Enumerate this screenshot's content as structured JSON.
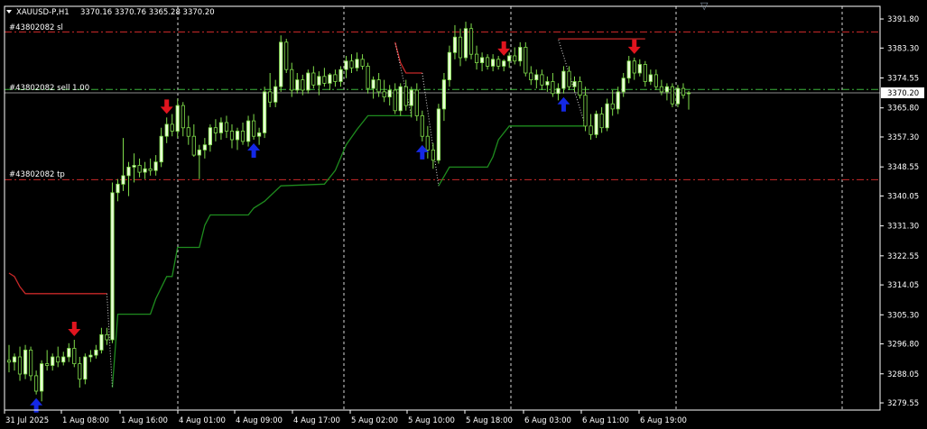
{
  "header": {
    "symbol_line": "XAUUSD-P,H1",
    "ohlc": "3370.16 3370.76 3365.28 3370.20"
  },
  "order_lines": {
    "sl_label": "#43802082 sl",
    "entry_label": "#43802082 sell 1.00",
    "tp_label": "#43802082 tp",
    "sl_price": 3388.0,
    "entry_price": 3371.2,
    "tp_price": 3344.8
  },
  "colors": {
    "background": "#000000",
    "bull_candle": "#e8ffd6",
    "bear_candle": "#000000",
    "candle_outline": "#7fdc4a",
    "trail_up": "#1e8c1e",
    "trail_down": "#c82828",
    "sell_arrow": "#e0141e",
    "buy_arrow": "#1428e6",
    "sl_tp_line": "#c82828",
    "entry_line": "#3cb43c",
    "current_price_line": "#8c8c8c",
    "grid_line": "#ffffff"
  },
  "chart_data": {
    "type": "candlestick",
    "title": "XAUUSD-P,H1",
    "ylim": [
      3277.45,
      3395.5
    ],
    "y_ticks": [
      3391.8,
      3383.3,
      3374.55,
      3365.8,
      3357.3,
      3348.55,
      3340.05,
      3331.3,
      3322.55,
      3314.05,
      3305.3,
      3296.8,
      3288.05,
      3279.55
    ],
    "x_tick_labels": [
      "31 Jul 2025",
      "1 Aug 08:00",
      "1 Aug 16:00",
      "4 Aug 01:00",
      "4 Aug 09:00",
      "4 Aug 17:00",
      "5 Aug 02:00",
      "5 Aug 10:00",
      "5 Aug 18:00",
      "6 Aug 03:00",
      "6 Aug 11:00",
      "6 Aug 19:00"
    ],
    "current_price": 3370.2,
    "candles": [
      {
        "o": 3292.0,
        "h": 3296.5,
        "l": 3288.5,
        "c": 3291.5
      },
      {
        "o": 3291.5,
        "h": 3294.0,
        "l": 3289.0,
        "c": 3293.0
      },
      {
        "o": 3293.0,
        "h": 3296.0,
        "l": 3286.0,
        "c": 3288.0
      },
      {
        "o": 3288.0,
        "h": 3296.5,
        "l": 3286.5,
        "c": 3295.0
      },
      {
        "o": 3295.0,
        "h": 3296.0,
        "l": 3286.0,
        "c": 3287.5
      },
      {
        "o": 3287.5,
        "h": 3289.0,
        "l": 3282.0,
        "c": 3283.0
      },
      {
        "o": 3283.0,
        "h": 3292.0,
        "l": 3280.0,
        "c": 3291.0
      },
      {
        "o": 3291.0,
        "h": 3295.0,
        "l": 3289.0,
        "c": 3290.5
      },
      {
        "o": 3290.5,
        "h": 3294.0,
        "l": 3289.0,
        "c": 3293.0
      },
      {
        "o": 3293.0,
        "h": 3296.0,
        "l": 3290.0,
        "c": 3291.5
      },
      {
        "o": 3291.5,
        "h": 3294.5,
        "l": 3290.5,
        "c": 3293.0
      },
      {
        "o": 3293.0,
        "h": 3297.0,
        "l": 3291.5,
        "c": 3295.5
      },
      {
        "o": 3295.5,
        "h": 3298.0,
        "l": 3290.0,
        "c": 3291.0
      },
      {
        "o": 3291.0,
        "h": 3293.0,
        "l": 3284.0,
        "c": 3286.5
      },
      {
        "o": 3286.5,
        "h": 3294.0,
        "l": 3285.0,
        "c": 3293.0
      },
      {
        "o": 3293.0,
        "h": 3295.0,
        "l": 3291.5,
        "c": 3293.5
      },
      {
        "o": 3293.5,
        "h": 3296.5,
        "l": 3292.5,
        "c": 3295.0
      },
      {
        "o": 3295.0,
        "h": 3301.5,
        "l": 3294.0,
        "c": 3299.5
      },
      {
        "o": 3299.5,
        "h": 3301.5,
        "l": 3296.5,
        "c": 3298.0
      },
      {
        "o": 3298.0,
        "h": 3344.0,
        "l": 3297.0,
        "c": 3341.0
      },
      {
        "o": 3341.0,
        "h": 3345.0,
        "l": 3338.5,
        "c": 3343.5
      },
      {
        "o": 3343.5,
        "h": 3357.0,
        "l": 3341.5,
        "c": 3346.0
      },
      {
        "o": 3346.0,
        "h": 3350.0,
        "l": 3340.0,
        "c": 3348.5
      },
      {
        "o": 3348.5,
        "h": 3352.5,
        "l": 3344.0,
        "c": 3349.0
      },
      {
        "o": 3349.0,
        "h": 3351.0,
        "l": 3345.5,
        "c": 3347.0
      },
      {
        "o": 3347.0,
        "h": 3350.0,
        "l": 3345.0,
        "c": 3348.0
      },
      {
        "o": 3348.0,
        "h": 3351.0,
        "l": 3346.0,
        "c": 3347.5
      },
      {
        "o": 3347.5,
        "h": 3352.0,
        "l": 3346.0,
        "c": 3350.0
      },
      {
        "o": 3350.0,
        "h": 3360.0,
        "l": 3348.5,
        "c": 3357.5
      },
      {
        "o": 3357.5,
        "h": 3363.0,
        "l": 3355.5,
        "c": 3361.0
      },
      {
        "o": 3361.0,
        "h": 3364.0,
        "l": 3357.5,
        "c": 3359.0
      },
      {
        "o": 3359.0,
        "h": 3368.5,
        "l": 3357.0,
        "c": 3366.5
      },
      {
        "o": 3366.5,
        "h": 3367.5,
        "l": 3357.5,
        "c": 3360.0
      },
      {
        "o": 3360.0,
        "h": 3363.5,
        "l": 3355.0,
        "c": 3357.5
      },
      {
        "o": 3357.5,
        "h": 3361.0,
        "l": 3351.5,
        "c": 3352.0
      },
      {
        "o": 3352.0,
        "h": 3355.0,
        "l": 3345.0,
        "c": 3353.5
      },
      {
        "o": 3353.5,
        "h": 3357.0,
        "l": 3351.0,
        "c": 3355.0
      },
      {
        "o": 3355.0,
        "h": 3361.0,
        "l": 3353.0,
        "c": 3360.0
      },
      {
        "o": 3360.0,
        "h": 3362.5,
        "l": 3356.0,
        "c": 3358.5
      },
      {
        "o": 3358.5,
        "h": 3363.0,
        "l": 3356.5,
        "c": 3361.5
      },
      {
        "o": 3361.5,
        "h": 3363.5,
        "l": 3357.0,
        "c": 3359.0
      },
      {
        "o": 3359.0,
        "h": 3361.0,
        "l": 3354.0,
        "c": 3356.5
      },
      {
        "o": 3356.5,
        "h": 3360.0,
        "l": 3353.5,
        "c": 3359.0
      },
      {
        "o": 3359.0,
        "h": 3361.5,
        "l": 3355.0,
        "c": 3356.0
      },
      {
        "o": 3356.0,
        "h": 3363.5,
        "l": 3354.5,
        "c": 3362.0
      },
      {
        "o": 3362.0,
        "h": 3364.0,
        "l": 3356.5,
        "c": 3357.5
      },
      {
        "o": 3357.5,
        "h": 3360.0,
        "l": 3355.0,
        "c": 3358.5
      },
      {
        "o": 3358.5,
        "h": 3372.0,
        "l": 3357.0,
        "c": 3370.5
      },
      {
        "o": 3370.5,
        "h": 3376.0,
        "l": 3366.0,
        "c": 3367.5
      },
      {
        "o": 3367.5,
        "h": 3374.0,
        "l": 3366.0,
        "c": 3372.0
      },
      {
        "o": 3372.0,
        "h": 3387.0,
        "l": 3370.5,
        "c": 3385.0
      },
      {
        "o": 3385.0,
        "h": 3386.0,
        "l": 3376.0,
        "c": 3377.0
      },
      {
        "o": 3377.0,
        "h": 3379.0,
        "l": 3369.0,
        "c": 3371.0
      },
      {
        "o": 3371.0,
        "h": 3376.0,
        "l": 3370.0,
        "c": 3374.0
      },
      {
        "o": 3374.0,
        "h": 3375.5,
        "l": 3369.5,
        "c": 3371.0
      },
      {
        "o": 3371.0,
        "h": 3377.0,
        "l": 3370.0,
        "c": 3376.0
      },
      {
        "o": 3376.0,
        "h": 3378.0,
        "l": 3371.5,
        "c": 3372.5
      },
      {
        "o": 3372.5,
        "h": 3376.5,
        "l": 3369.5,
        "c": 3375.0
      },
      {
        "o": 3375.0,
        "h": 3377.5,
        "l": 3372.0,
        "c": 3373.0
      },
      {
        "o": 3373.0,
        "h": 3376.0,
        "l": 3371.0,
        "c": 3375.5
      },
      {
        "o": 3375.5,
        "h": 3377.0,
        "l": 3372.0,
        "c": 3373.5
      },
      {
        "o": 3373.5,
        "h": 3378.0,
        "l": 3372.0,
        "c": 3377.0
      },
      {
        "o": 3377.0,
        "h": 3381.0,
        "l": 3374.5,
        "c": 3379.5
      },
      {
        "o": 3379.5,
        "h": 3381.5,
        "l": 3376.0,
        "c": 3377.5
      },
      {
        "o": 3377.5,
        "h": 3382.0,
        "l": 3376.5,
        "c": 3380.0
      },
      {
        "o": 3380.0,
        "h": 3381.5,
        "l": 3377.0,
        "c": 3378.0
      },
      {
        "o": 3378.0,
        "h": 3379.0,
        "l": 3370.0,
        "c": 3371.5
      },
      {
        "o": 3371.5,
        "h": 3375.0,
        "l": 3368.5,
        "c": 3374.0
      },
      {
        "o": 3374.0,
        "h": 3376.0,
        "l": 3369.0,
        "c": 3370.5
      },
      {
        "o": 3370.5,
        "h": 3374.0,
        "l": 3367.5,
        "c": 3369.0
      },
      {
        "o": 3369.0,
        "h": 3372.5,
        "l": 3366.5,
        "c": 3371.0
      },
      {
        "o": 3371.0,
        "h": 3373.0,
        "l": 3364.0,
        "c": 3365.0
      },
      {
        "o": 3365.0,
        "h": 3373.0,
        "l": 3363.5,
        "c": 3372.0
      },
      {
        "o": 3372.0,
        "h": 3374.0,
        "l": 3365.0,
        "c": 3366.5
      },
      {
        "o": 3366.5,
        "h": 3372.0,
        "l": 3363.0,
        "c": 3371.0
      },
      {
        "o": 3371.0,
        "h": 3373.0,
        "l": 3362.0,
        "c": 3363.5
      },
      {
        "o": 3363.5,
        "h": 3365.0,
        "l": 3356.0,
        "c": 3357.5
      },
      {
        "o": 3357.5,
        "h": 3360.5,
        "l": 3351.0,
        "c": 3353.5
      },
      {
        "o": 3353.5,
        "h": 3355.5,
        "l": 3348.0,
        "c": 3350.5
      },
      {
        "o": 3350.5,
        "h": 3367.0,
        "l": 3349.5,
        "c": 3365.5
      },
      {
        "o": 3365.5,
        "h": 3376.0,
        "l": 3362.0,
        "c": 3374.0
      },
      {
        "o": 3374.0,
        "h": 3384.0,
        "l": 3372.0,
        "c": 3382.0
      },
      {
        "o": 3382.0,
        "h": 3390.0,
        "l": 3380.0,
        "c": 3386.5
      },
      {
        "o": 3386.5,
        "h": 3389.0,
        "l": 3378.0,
        "c": 3380.5
      },
      {
        "o": 3380.5,
        "h": 3391.0,
        "l": 3379.5,
        "c": 3389.0
      },
      {
        "o": 3389.0,
        "h": 3390.5,
        "l": 3380.0,
        "c": 3381.5
      },
      {
        "o": 3381.5,
        "h": 3384.0,
        "l": 3377.0,
        "c": 3379.0
      },
      {
        "o": 3379.0,
        "h": 3382.0,
        "l": 3376.5,
        "c": 3380.5
      },
      {
        "o": 3380.5,
        "h": 3381.5,
        "l": 3377.0,
        "c": 3378.0
      },
      {
        "o": 3378.0,
        "h": 3381.5,
        "l": 3376.5,
        "c": 3380.0
      },
      {
        "o": 3380.0,
        "h": 3381.0,
        "l": 3377.0,
        "c": 3378.0
      },
      {
        "o": 3378.0,
        "h": 3380.0,
        "l": 3376.5,
        "c": 3379.5
      },
      {
        "o": 3379.5,
        "h": 3382.0,
        "l": 3377.5,
        "c": 3381.0
      },
      {
        "o": 3381.0,
        "h": 3383.5,
        "l": 3378.5,
        "c": 3379.5
      },
      {
        "o": 3379.5,
        "h": 3385.0,
        "l": 3378.0,
        "c": 3383.5
      },
      {
        "o": 3383.5,
        "h": 3385.0,
        "l": 3375.0,
        "c": 3376.0
      },
      {
        "o": 3376.0,
        "h": 3378.0,
        "l": 3372.5,
        "c": 3374.0
      },
      {
        "o": 3374.0,
        "h": 3377.0,
        "l": 3371.5,
        "c": 3375.5
      },
      {
        "o": 3375.5,
        "h": 3377.0,
        "l": 3371.0,
        "c": 3372.5
      },
      {
        "o": 3372.5,
        "h": 3375.0,
        "l": 3370.5,
        "c": 3373.5
      },
      {
        "o": 3373.5,
        "h": 3376.0,
        "l": 3369.0,
        "c": 3370.0
      },
      {
        "o": 3370.0,
        "h": 3373.0,
        "l": 3368.0,
        "c": 3371.5
      },
      {
        "o": 3371.5,
        "h": 3378.0,
        "l": 3370.0,
        "c": 3376.5
      },
      {
        "o": 3376.5,
        "h": 3378.0,
        "l": 3371.0,
        "c": 3372.0
      },
      {
        "o": 3372.0,
        "h": 3375.0,
        "l": 3370.5,
        "c": 3373.5
      },
      {
        "o": 3373.5,
        "h": 3375.0,
        "l": 3368.5,
        "c": 3369.5
      },
      {
        "o": 3369.5,
        "h": 3372.0,
        "l": 3359.0,
        "c": 3360.5
      },
      {
        "o": 3360.5,
        "h": 3364.0,
        "l": 3356.5,
        "c": 3358.0
      },
      {
        "o": 3358.0,
        "h": 3365.0,
        "l": 3357.0,
        "c": 3364.0
      },
      {
        "o": 3364.0,
        "h": 3366.0,
        "l": 3358.5,
        "c": 3360.0
      },
      {
        "o": 3360.0,
        "h": 3368.5,
        "l": 3359.0,
        "c": 3367.0
      },
      {
        "o": 3367.0,
        "h": 3371.0,
        "l": 3363.5,
        "c": 3365.5
      },
      {
        "o": 3365.5,
        "h": 3372.0,
        "l": 3364.0,
        "c": 3370.5
      },
      {
        "o": 3370.5,
        "h": 3376.0,
        "l": 3369.0,
        "c": 3374.5
      },
      {
        "o": 3374.5,
        "h": 3381.0,
        "l": 3373.0,
        "c": 3379.5
      },
      {
        "o": 3379.5,
        "h": 3380.5,
        "l": 3374.0,
        "c": 3376.0
      },
      {
        "o": 3376.0,
        "h": 3380.0,
        "l": 3375.0,
        "c": 3378.5
      },
      {
        "o": 3378.5,
        "h": 3379.5,
        "l": 3372.0,
        "c": 3373.5
      },
      {
        "o": 3373.5,
        "h": 3377.0,
        "l": 3372.5,
        "c": 3375.5
      },
      {
        "o": 3375.5,
        "h": 3377.0,
        "l": 3371.0,
        "c": 3372.0
      },
      {
        "o": 3372.0,
        "h": 3374.0,
        "l": 3369.5,
        "c": 3370.5
      },
      {
        "o": 3370.5,
        "h": 3373.0,
        "l": 3368.0,
        "c": 3372.0
      },
      {
        "o": 3372.0,
        "h": 3373.0,
        "l": 3366.0,
        "c": 3367.0
      },
      {
        "o": 3367.0,
        "h": 3372.5,
        "l": 3366.0,
        "c": 3371.5
      },
      {
        "o": 3371.5,
        "h": 3373.0,
        "l": 3368.5,
        "c": 3369.5
      },
      {
        "o": 3370.16,
        "h": 3370.76,
        "l": 3365.28,
        "c": 3370.2
      }
    ],
    "trail_up_series": [
      {
        "i": 19,
        "v": 3284.0
      },
      {
        "i": 20,
        "v": 3305.5
      },
      {
        "i": 26,
        "v": 3305.5
      },
      {
        "i": 27,
        "v": 3310.0
      },
      {
        "i": 29,
        "v": 3316.5
      },
      {
        "i": 30,
        "v": 3316.5
      },
      {
        "i": 31,
        "v": 3325.0
      },
      {
        "i": 35,
        "v": 3325.0
      },
      {
        "i": 36,
        "v": 3331.5
      },
      {
        "i": 37,
        "v": 3334.5
      },
      {
        "i": 44,
        "v": 3334.5
      },
      {
        "i": 45,
        "v": 3336.5
      },
      {
        "i": 47,
        "v": 3338.5
      },
      {
        "i": 50,
        "v": 3343.0
      },
      {
        "i": 58,
        "v": 3343.5
      },
      {
        "i": 60,
        "v": 3347.5
      },
      {
        "i": 62,
        "v": 3355.0
      },
      {
        "i": 64,
        "v": 3359.5
      },
      {
        "i": 66,
        "v": 3363.5
      },
      {
        "i": 73,
        "v": 3363.5
      },
      {
        "i": 74,
        "v": 3363.5
      }
    ],
    "trail_up_series_2": [
      {
        "i": 79,
        "v": 3343.0
      },
      {
        "i": 81,
        "v": 3348.5
      },
      {
        "i": 88,
        "v": 3348.5
      },
      {
        "i": 89,
        "v": 3351.5
      },
      {
        "i": 90,
        "v": 3356.5
      },
      {
        "i": 92,
        "v": 3360.5
      },
      {
        "i": 106,
        "v": 3360.5
      }
    ],
    "trail_down_series": [
      {
        "i": 0,
        "v": 3317.5
      },
      {
        "i": 1,
        "v": 3316.5
      },
      {
        "i": 2,
        "v": 3313.5
      },
      {
        "i": 3,
        "v": 3311.5
      },
      {
        "i": 18,
        "v": 3311.5
      }
    ],
    "trail_down_series_2": [
      {
        "i": 71,
        "v": 3385.0
      },
      {
        "i": 72,
        "v": 3379.0
      },
      {
        "i": 73,
        "v": 3376.0
      },
      {
        "i": 76,
        "v": 3376.0
      }
    ],
    "trail_down_series_3": [
      {
        "i": 101,
        "v": 3386.0
      },
      {
        "i": 117,
        "v": 3386.0
      }
    ],
    "sell_signals": [
      12,
      29,
      91,
      115
    ],
    "buy_signals": [
      5,
      45,
      76,
      102
    ]
  },
  "scroll_marker": "▽"
}
